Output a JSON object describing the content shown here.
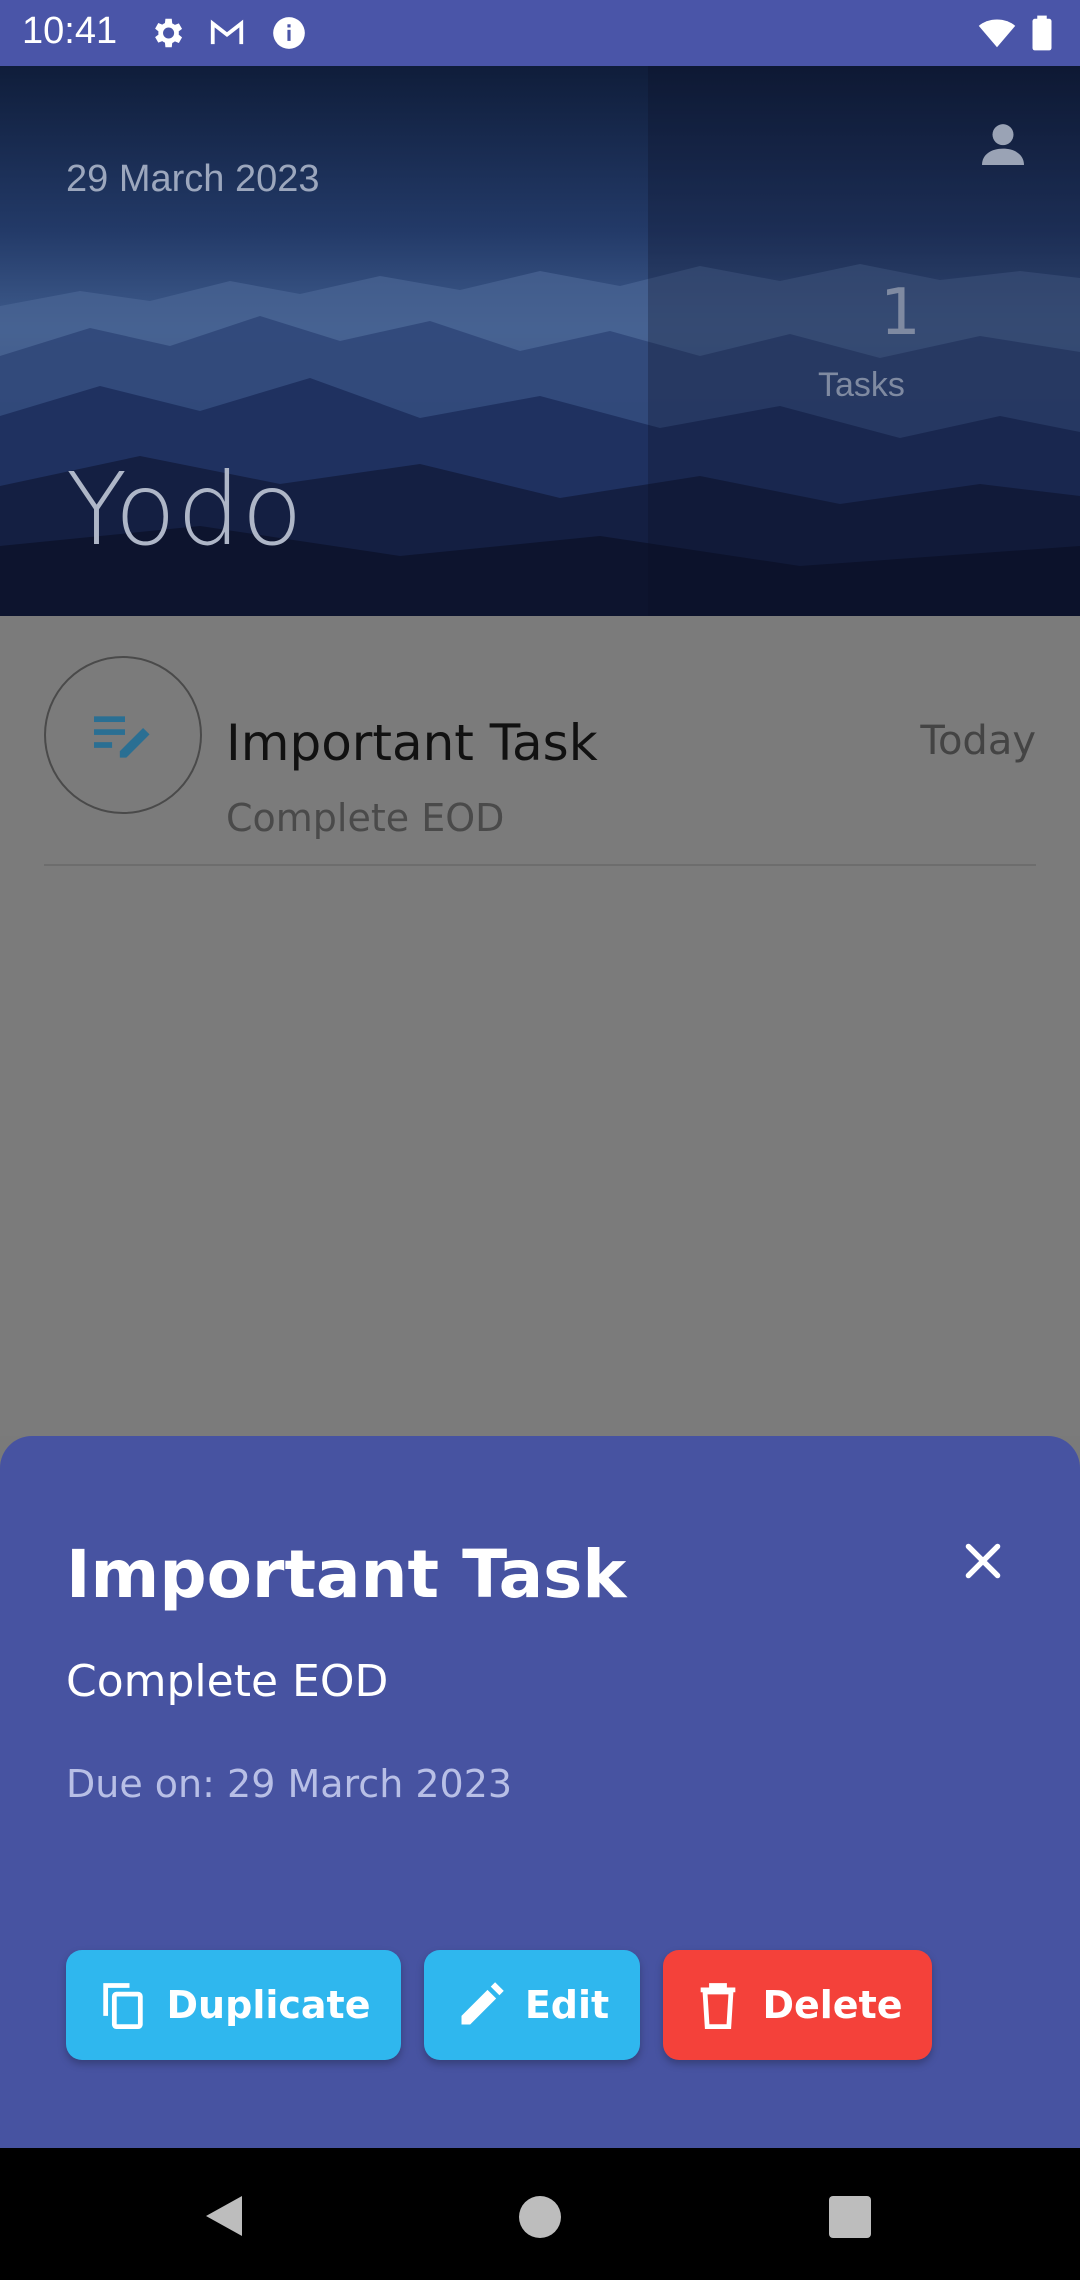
{
  "status_bar": {
    "time": "10:41",
    "icons": [
      "settings-icon",
      "gmail-icon",
      "info-icon",
      "wifi-icon",
      "battery-icon"
    ]
  },
  "header": {
    "date": "29 March 2023",
    "app_title": "Yodo",
    "task_count": "1",
    "task_count_label": "Tasks",
    "progress_fraction": 0.6
  },
  "tasks": [
    {
      "title": "Important Task",
      "subtitle": "Complete EOD",
      "date": "Today",
      "icon": "edit-note-icon"
    }
  ],
  "sheet": {
    "title": "Important Task",
    "description": "Complete EOD",
    "due": "Due on: 29 March 2023",
    "buttons": {
      "duplicate": "Duplicate",
      "edit": "Edit",
      "delete": "Delete"
    }
  },
  "colors": {
    "status_bar": "#4a55a8",
    "sheet": "#4753a1",
    "button_blue": "#2fb7ee",
    "button_red": "#f4413a",
    "progress": "#3a8ab8"
  }
}
